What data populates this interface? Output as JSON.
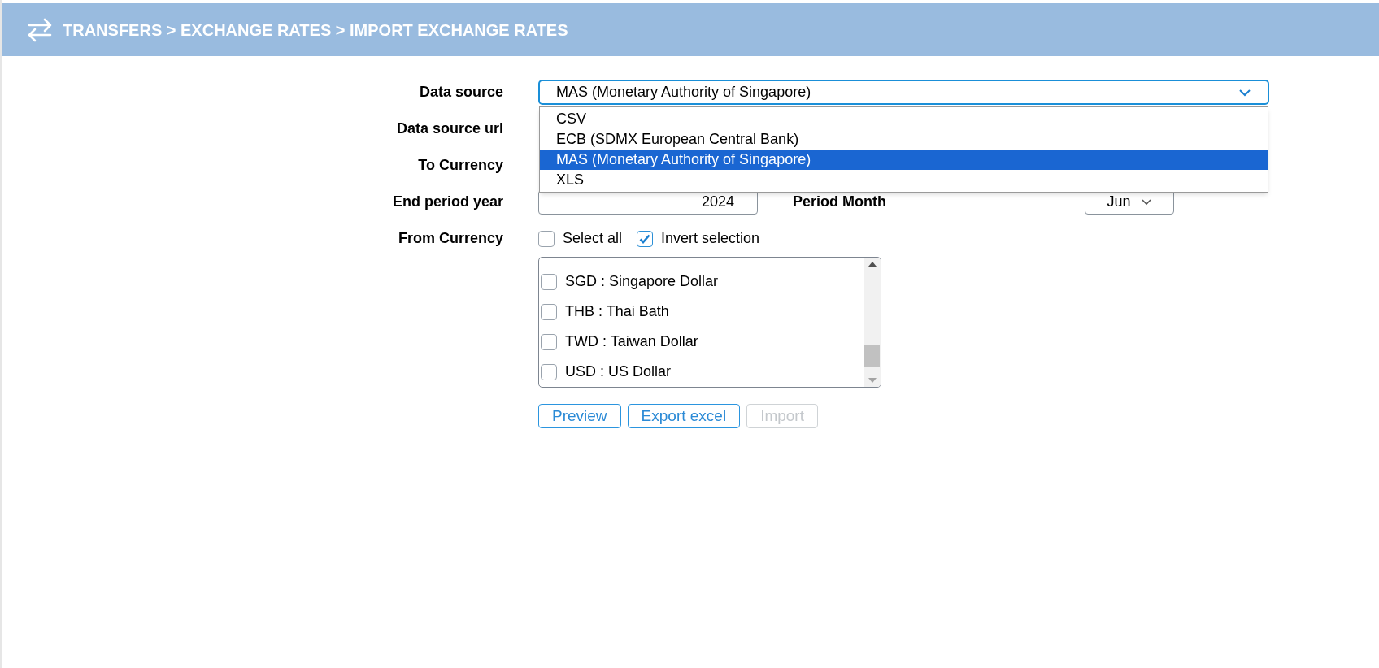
{
  "header": {
    "title": "TRANSFERS > EXCHANGE RATES > IMPORT EXCHANGE RATES"
  },
  "form": {
    "data_source": {
      "label": "Data source",
      "value": "MAS (Monetary Authority of Singapore)",
      "expanded": true,
      "options": [
        {
          "label": "CSV",
          "selected": false
        },
        {
          "label": "ECB (SDMX European Central Bank)",
          "selected": false
        },
        {
          "label": "MAS (Monetary Authority of Singapore)",
          "selected": true
        },
        {
          "label": "XLS",
          "selected": false
        }
      ]
    },
    "data_source_url": {
      "label": "Data source url"
    },
    "to_currency": {
      "label": "To Currency"
    },
    "end_period_year": {
      "label": "End period year",
      "value": "2024"
    },
    "period_month": {
      "label": "Period Month",
      "value": "Jun"
    },
    "from_currency": {
      "label": "From Currency",
      "toggles": [
        {
          "label": "Select all",
          "checked": false
        },
        {
          "label": "Invert selection",
          "checked": true
        }
      ],
      "items": [
        {
          "label": "SGD : Singapore Dollar",
          "checked": false
        },
        {
          "label": "THB : Thai Bath",
          "checked": false
        },
        {
          "label": "TWD : Taiwan Dollar",
          "checked": false
        },
        {
          "label": "USD : US Dollar",
          "checked": false
        }
      ]
    }
  },
  "buttons": [
    {
      "label": "Preview",
      "disabled": false
    },
    {
      "label": "Export excel",
      "disabled": false
    },
    {
      "label": "Import",
      "disabled": true
    }
  ]
}
